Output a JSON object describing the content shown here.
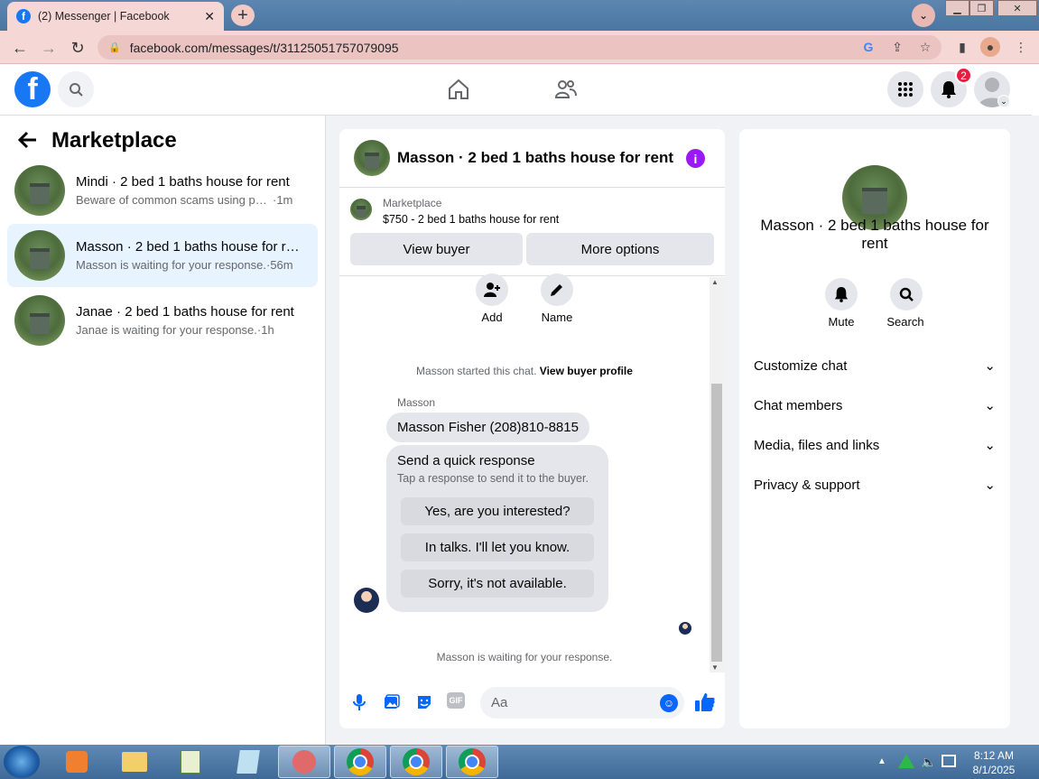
{
  "browser": {
    "tab_title": "(2) Messenger | Facebook",
    "tab_close": "✕",
    "new_tab": "+",
    "url": "facebook.com/messages/t/31125051757079095"
  },
  "header": {
    "notification_count": "2"
  },
  "left_panel": {
    "title": "Marketplace",
    "conversations": [
      {
        "title": "Mindi · 2 bed 1 baths house for rent",
        "preview": "Beware of common scams using pay...",
        "time": " ·1m"
      },
      {
        "title": "Masson · 2 bed 1 baths house for rent",
        "preview": "Masson is waiting for your response.",
        "time": " ·56m"
      },
      {
        "title": "Janae · 2 bed 1 baths house for rent",
        "preview": "Janae is waiting for your response.",
        "time": " ·1h"
      }
    ]
  },
  "chat": {
    "title": "Masson · 2 bed 1 baths house for rent",
    "marketplace_label": "Marketplace",
    "listing": "$750 - 2 bed 1 baths house for rent",
    "view_buyer": "View buyer",
    "more_options": "More options",
    "add_label": "Add",
    "name_label": "Name",
    "started_text": "Masson started this chat.",
    "view_buyer_profile": "View buyer profile",
    "sender": "Masson",
    "message": "Masson Fisher (208)810-8815",
    "quick_title": "Send a quick response",
    "quick_sub": "Tap a response to send it to the buyer.",
    "quick_replies": [
      "Yes, are you interested?",
      "In talks. I'll let you know.",
      "Sorry, it's not available."
    ],
    "waiting": "Masson is waiting for your response.",
    "input_placeholder": "Aa"
  },
  "right_panel": {
    "title": "Masson · 2 bed 1 baths house for rent",
    "mute": "Mute",
    "search": "Search",
    "sections": [
      "Customize chat",
      "Chat members",
      "Media, files and links",
      "Privacy & support"
    ]
  },
  "taskbar": {
    "time": "8:12 AM",
    "date": "8/1/2025"
  },
  "colors": {
    "brand": "#1877f2",
    "messenger": "#0866ff",
    "info": "#9b19f5",
    "badge": "#e41e3f"
  }
}
